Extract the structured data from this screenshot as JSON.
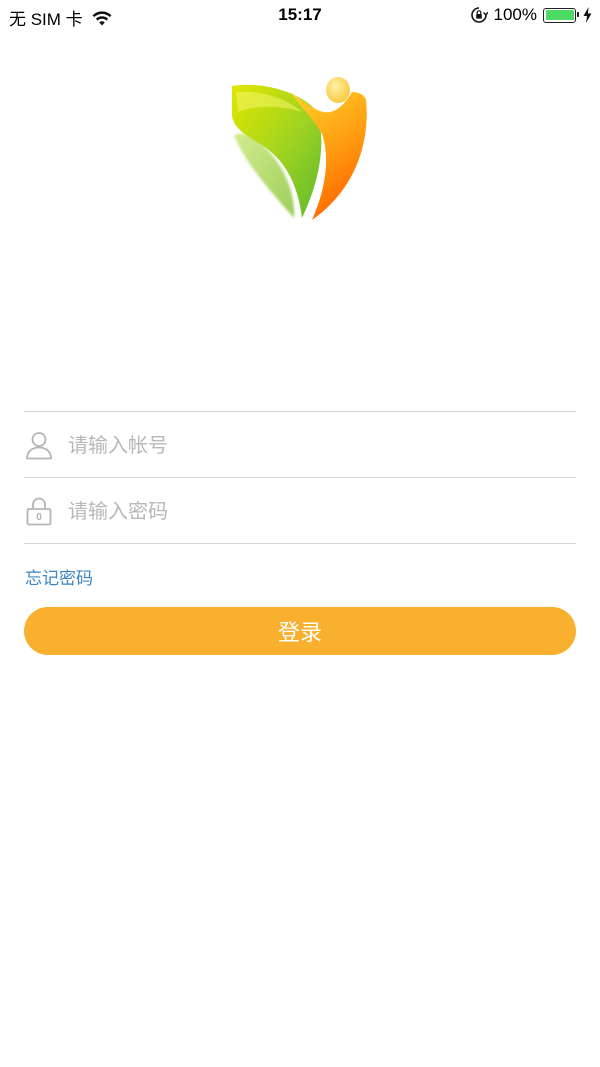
{
  "status_bar": {
    "carrier": "无 SIM 卡",
    "time": "15:17",
    "battery_percent": "100%",
    "battery_level": 1.0,
    "icons": [
      "wifi-icon",
      "orientation-lock-icon",
      "battery-icon",
      "charging-icon"
    ]
  },
  "logo": {
    "icon": "leaf-person-logo",
    "colors": {
      "green": "#8cc63f",
      "yellow_green": "#c8dc1e",
      "orange": "#ff7a00",
      "yellow": "#ffc21a"
    }
  },
  "login_form": {
    "account": {
      "icon": "user-icon",
      "value": "",
      "placeholder": "请输入帐号"
    },
    "password": {
      "icon": "lock-icon",
      "value": "",
      "placeholder": "请输入密码"
    },
    "forgot_password_label": "忘记密码",
    "login_button_label": "登录"
  },
  "colors": {
    "accent": "#f8b02e",
    "link": "#3b84c5",
    "placeholder": "#b8b8b8",
    "divider": "#d8d8d8",
    "battery_fill": "#4cd964"
  }
}
